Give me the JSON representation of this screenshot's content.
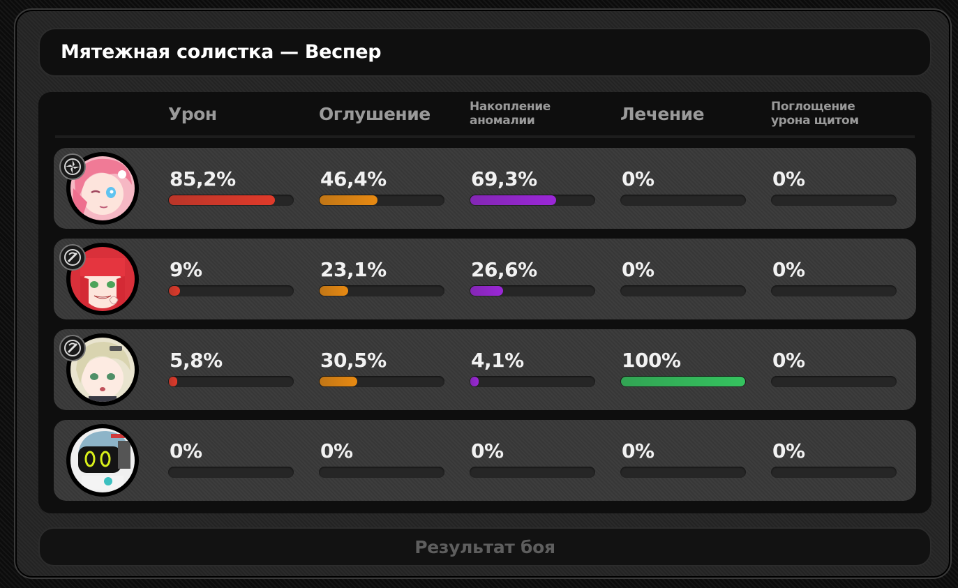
{
  "title": "Мятежная солистка — Веспер",
  "columns": [
    {
      "key": "damage",
      "label": "Урон",
      "size": "big",
      "color": "#e03a2a"
    },
    {
      "key": "stun",
      "label": "Оглушение",
      "size": "big",
      "color": "#e88a12"
    },
    {
      "key": "anomaly",
      "label": "Накопление аномалии",
      "label_line1": "Накопление",
      "label_line2": "аномалии",
      "size": "small",
      "color": "#9b27d8"
    },
    {
      "key": "healing",
      "label": "Лечение",
      "size": "big",
      "color": "#35c35f"
    },
    {
      "key": "shield",
      "label": "Поглощение урона щитом",
      "label_line1": "Поглощение",
      "label_line2": "урона щитом",
      "size": "small",
      "color": "#2a9bd8"
    }
  ],
  "rows": [
    {
      "avatar": "pink-haired-character-avatar",
      "element_icon": "ether-element-icon",
      "values": [
        "85,2%",
        "46,4%",
        "69,3%",
        "0%",
        "0%"
      ],
      "fractions": [
        0.852,
        0.464,
        0.693,
        0,
        0
      ]
    },
    {
      "avatar": "red-haired-character-avatar",
      "element_icon": "physical-element-icon",
      "values": [
        "9%",
        "23,1%",
        "26,6%",
        "0%",
        "0%"
      ],
      "fractions": [
        0.09,
        0.231,
        0.266,
        0,
        0
      ]
    },
    {
      "avatar": "blonde-haired-character-avatar",
      "element_icon": "physical-element-icon",
      "values": [
        "5,8%",
        "30,5%",
        "4,1%",
        "100%",
        "0%"
      ],
      "fractions": [
        0.058,
        0.305,
        0.041,
        1.0,
        0
      ]
    },
    {
      "avatar": "bangboo-avatar",
      "element_icon": "",
      "values": [
        "0%",
        "0%",
        "0%",
        "0%",
        "0%"
      ],
      "fractions": [
        0,
        0,
        0,
        0,
        0
      ]
    }
  ],
  "result_button": "Результат боя"
}
